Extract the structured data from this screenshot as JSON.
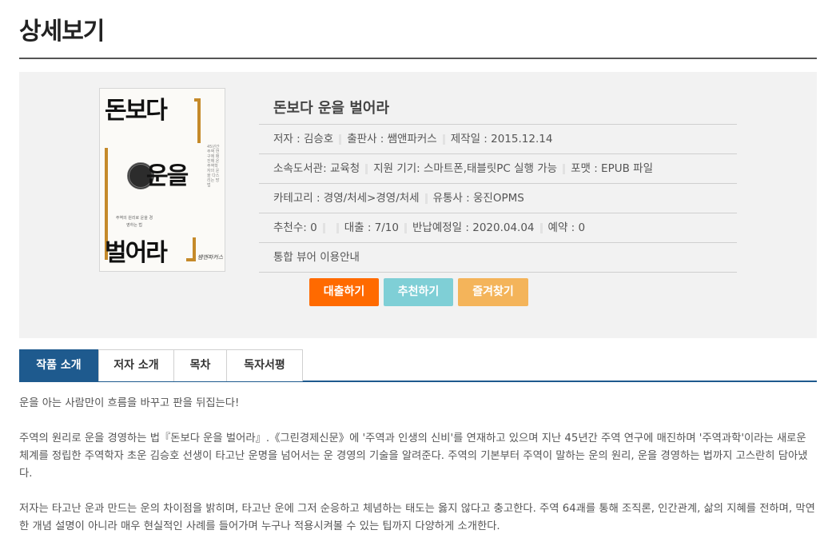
{
  "page": {
    "title": "상세보기"
  },
  "cover": {
    "line1": "돈보다",
    "line2": "운을",
    "line3": "벌어라",
    "sub": "주역의 원리로 운을 경영하는 법",
    "vertical": "45년간 주역 연구에 매진해 온 주역학자의 운을 다스리는 방법",
    "publisher": "쌤앤파커스"
  },
  "book": {
    "title": "돈보다 운을 벌어라",
    "author": "저자 : 김승호",
    "publisher": "출판사 : 쌤앤파커스",
    "made": "제작일 : 2015.12.14",
    "library": "소속도서관: 교육청",
    "device": "지원 기기: 스마트폰,태블릿PC 실행 가능",
    "format": "포맷 : EPUB 파일",
    "category": "카테고리 : 경영/처세>경영/처세",
    "distributor": "유통사 : 웅진OPMS",
    "recommend": "추천수: 0",
    "loan": "대출 : 7/10",
    "due": "반납예정일 : 2020.04.04",
    "reserve": "예약 : 0",
    "viewer_guide": "통합 뷰어 이용안내"
  },
  "buttons": {
    "loan": "대출하기",
    "recommend": "추천하기",
    "favorite": "즐겨찾기"
  },
  "colors": {
    "loan": "#ff6a00",
    "recommend": "#7fcfd6",
    "favorite": "#f4b45a",
    "tab_active": "#1e5a8e"
  },
  "tabs": [
    {
      "label": "작품 소개",
      "active": true
    },
    {
      "label": "저자 소개",
      "active": false
    },
    {
      "label": "목차",
      "active": false
    },
    {
      "label": "독자서평",
      "active": false
    }
  ],
  "content": {
    "p1": "운을 아는 사람만이 흐름을 바꾸고 판을 뒤집는다!",
    "p2": "주역의 원리로 운을 경영하는 법『돈보다 운을 벌어라』.《그린경제신문》에 '주역과 인생의 신비'를 연재하고 있으며 지난 45년간 주역 연구에 매진하며 '주역과학'이라는 새로운 체계를 정립한 주역학자 초운 김승호 선생이 타고난 운명을 넘어서는 운 경영의 기술을 알려준다. 주역의 기본부터 주역이 말하는 운의 원리, 운을 경영하는 법까지 고스란히 담아냈다.",
    "p3": "저자는 타고난 운과 만드는 운의 차이점을 밝히며, 타고난 운에 그저 순응하고 체념하는 태도는 옳지 않다고 충고한다. 주역 64괘를 통해 조직론, 인간관계, 삶의 지혜를 전하며, 막연한 개념 설명이 아니라 매우 현실적인 사례를 들어가며 누구나 적용시켜볼 수 있는 팁까지 다양하게 소개한다."
  }
}
